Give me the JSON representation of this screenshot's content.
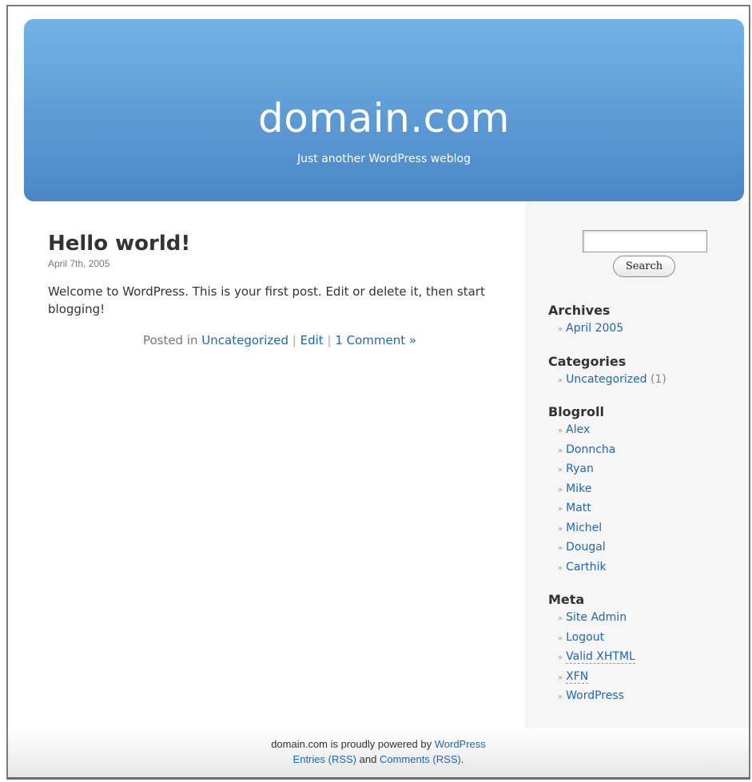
{
  "header": {
    "title": "domain.com",
    "description": "Just another WordPress weblog"
  },
  "post": {
    "title": "Hello world!",
    "date": "April 7th, 2005",
    "body": "Welcome to WordPress. This is your first post. Edit or delete it, then start blogging!",
    "meta": {
      "posted_in": "Posted in",
      "category": "Uncategorized",
      "separator": "|",
      "edit": "Edit",
      "comments": "1 Comment »"
    }
  },
  "sidebar": {
    "search": {
      "value": "",
      "button_label": "Search"
    },
    "bullet": "»",
    "archives": {
      "title": "Archives",
      "items": [
        "April 2005"
      ]
    },
    "categories": {
      "title": "Categories",
      "items": [
        {
          "label": "Uncategorized",
          "count": "(1)"
        }
      ]
    },
    "blogroll": {
      "title": "Blogroll",
      "items": [
        "Alex",
        "Donncha",
        "Ryan",
        "Mike",
        "Matt",
        "Michel",
        "Dougal",
        "Carthik"
      ]
    },
    "meta": {
      "title": "Meta",
      "items": [
        "Site Admin",
        "Logout",
        "Valid XHTML",
        "XFN",
        "WordPress"
      ]
    }
  },
  "footer": {
    "powered_text": "domain.com is proudly powered by",
    "wordpress_link": "WordPress",
    "entries_rss": "Entries (RSS)",
    "and": "and",
    "comments_rss": "Comments (RSS)",
    "end": "."
  },
  "colors": {
    "link": "#1e66b8",
    "header_top": "#73b2e6",
    "header_bottom": "#4a86c6"
  }
}
